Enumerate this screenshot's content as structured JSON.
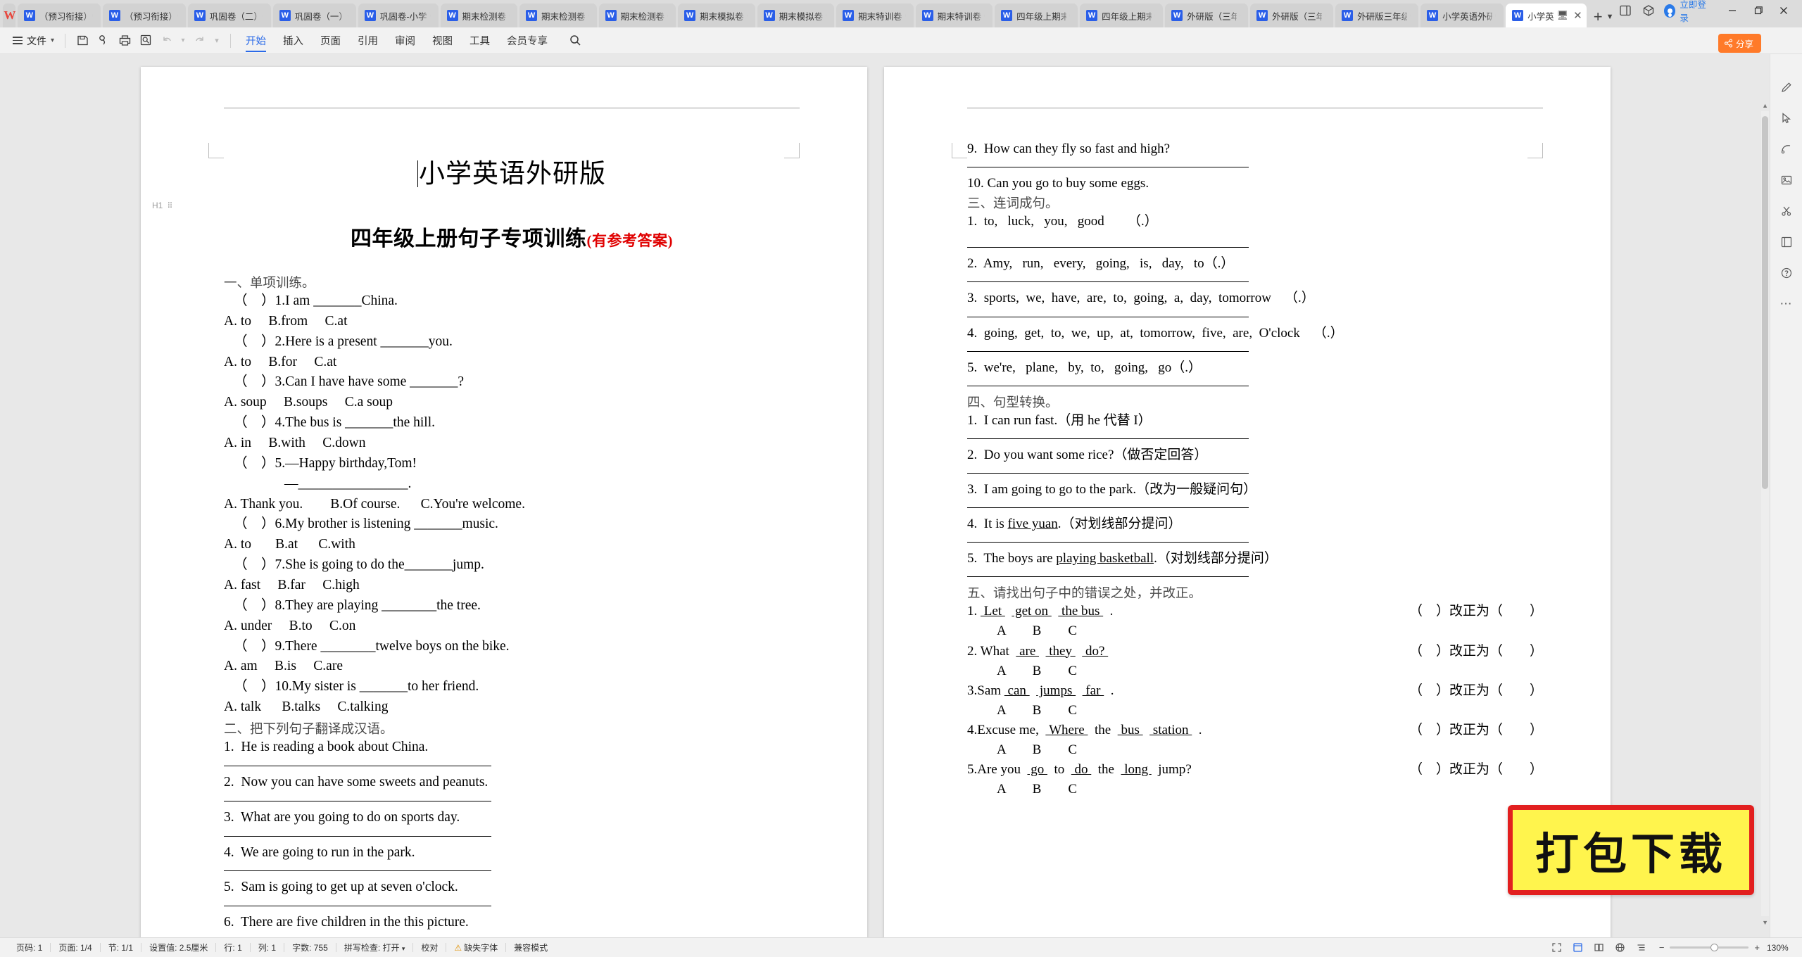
{
  "app": {
    "logo": "W",
    "login_label": "立即登录"
  },
  "tabs": [
    {
      "label": "（预习衔接）",
      "active": false,
      "dot": true
    },
    {
      "label": "（预习衔接）",
      "active": false,
      "dot": true
    },
    {
      "label": "巩固卷（二）",
      "active": false,
      "dot": true
    },
    {
      "label": "巩固卷（一）",
      "active": false,
      "dot": true
    },
    {
      "label": "巩固卷-小学",
      "active": false,
      "dot": true
    },
    {
      "label": "期末检测卷",
      "active": false,
      "dot": true
    },
    {
      "label": "期末检测卷",
      "active": false,
      "dot": true
    },
    {
      "label": "期末检测卷",
      "active": false,
      "dot": true
    },
    {
      "label": "期末模拟卷",
      "active": false,
      "dot": true
    },
    {
      "label": "期末模拟卷",
      "active": false,
      "dot": true
    },
    {
      "label": "期末特训卷",
      "active": false,
      "dot": true
    },
    {
      "label": "期末特训卷",
      "active": false,
      "dot": true
    },
    {
      "label": "四年级上期末",
      "active": false,
      "dot": true
    },
    {
      "label": "四年级上期末",
      "active": false,
      "dot": true
    },
    {
      "label": "外研版（三年",
      "active": false,
      "dot": true
    },
    {
      "label": "外研版（三年",
      "active": false,
      "dot": true
    },
    {
      "label": "外研版三年级",
      "active": false,
      "dot": true
    },
    {
      "label": "小学英语外研",
      "active": false,
      "dot": true
    },
    {
      "label": "小学英",
      "active": true,
      "dot": false
    }
  ],
  "menu": {
    "file_label": "文件",
    "tabs": [
      {
        "label": "开始",
        "active": true
      },
      {
        "label": "插入",
        "active": false
      },
      {
        "label": "页面",
        "active": false
      },
      {
        "label": "引用",
        "active": false
      },
      {
        "label": "审阅",
        "active": false
      },
      {
        "label": "视图",
        "active": false
      },
      {
        "label": "工具",
        "active": false
      },
      {
        "label": "会员专享",
        "active": false
      }
    ],
    "quick_icons": [
      "save-icon",
      "link-icon",
      "print-icon",
      "print-preview-icon",
      "undo-icon",
      "redo-icon",
      "more-chevron-icon"
    ]
  },
  "share_button": "分享",
  "document": {
    "title": "小学英语外研版",
    "subtitle": "四年级上册句子专项训练",
    "subtitle_note": "(有参考答案)",
    "paragraph_handle": "H1",
    "left_page": {
      "section1_head": "一、单项训练。",
      "questions": [
        {
          "stem": "（    ）1.I am _______China.",
          "options": "A. to     B.from     C.at"
        },
        {
          "stem": "（    ）2.Here is a present _______you.",
          "options": "A. to     B.for     C.at"
        },
        {
          "stem": "（    ）3.Can I have have some _______?",
          "options": "A. soup     B.soups     C.a soup"
        },
        {
          "stem": "（    ）4.The bus is _______the hill.",
          "options": "A. in     B.with     C.down"
        },
        {
          "stem": "（    ）5.—Happy birthday,Tom!",
          "sub": "—________________.",
          "options": "A. Thank you.        B.Of course.      C.You're welcome."
        },
        {
          "stem": "（    ）6.My brother is listening _______music.",
          "options": "A. to       B.at      C.with"
        },
        {
          "stem": "（    ）7.She is going to do the_______jump.",
          "options": "A. fast     B.far     C.high"
        },
        {
          "stem": "（    ）8.They are playing ________the tree.",
          "options": "A. under     B.to     C.on"
        },
        {
          "stem": "（    ）9.There ________twelve boys on the bike.",
          "options": "A. am     B.is     C.are"
        },
        {
          "stem": "（    ）10.My sister is _______to her friend.",
          "options": "A. talk      B.talks     C.talking"
        }
      ],
      "section2_head": "二、把下列句子翻译成汉语。",
      "translate": [
        "1.  He is reading a book about China.",
        "2.  Now you can have some sweets and peanuts.",
        "3.  What are you going to do on sports day.",
        "4.  We are going to run in the park.",
        "5.  Sam is going to get up at seven o'clock.",
        "6.  There are five children in the this picture."
      ]
    },
    "right_page": {
      "translate_cont": [
        "9.  How can they fly so fast and high?",
        "10. Can you go to buy some eggs."
      ],
      "section3_head": "三、连词成句。",
      "wordorder": [
        "1.  to,   luck,   you,   good       （.）",
        "2.  Amy,   run,   every,   going,   is,   day,   to（.）",
        "3.  sports,  we,  have,  are,  to,  going,  a,  day,  tomorrow    （.）",
        "4.  going,  get,  to,  we,  up,  at,  tomorrow,  five,  are,  O'clock    （.）",
        "5.  we're,   plane,   by,  to,   going,   go（.）"
      ],
      "section4_head": "四、句型转换。",
      "transform": [
        {
          "pre": "1.  I can run fast.（用 he 代替 I）"
        },
        {
          "pre": "2.  Do you want some rice?（做否定回答）"
        },
        {
          "pre": "3.  I am going to go to the park.（改为一般疑问句）"
        },
        {
          "pre": "4.  It is ",
          "ul": "five yuan",
          "post": ".（对划线部分提问）"
        },
        {
          "pre": "5.  The boys are ",
          "ul": "playing basketball",
          "post": ".（对划线部分提问）"
        }
      ],
      "section5_head": "五、请找出句子中的错误之处，并改正。",
      "correct_suffix": "）改正为（        ）",
      "correct_open": "（",
      "corrections": [
        {
          "num": "1.",
          "parts": [
            {
              "t": "Let",
              "ul": true
            },
            {
              "t": "get on",
              "ul": true
            },
            {
              "t": "the bus",
              "ul": true
            },
            {
              "t": ".",
              "ul": false
            }
          ],
          "marks": [
            "A",
            "B",
            "C"
          ]
        },
        {
          "num": "2.",
          "parts": [
            {
              "t": "What",
              "ul": false
            },
            {
              "t": "are",
              "ul": true
            },
            {
              "t": "they",
              "ul": true
            },
            {
              "t": "do?",
              "ul": true
            }
          ],
          "marks": [
            "A",
            "B",
            "C"
          ]
        },
        {
          "num": "3.Sam",
          "parts": [
            {
              "t": "can",
              "ul": true
            },
            {
              "t": "jumps",
              "ul": true
            },
            {
              "t": "far",
              "ul": true
            },
            {
              "t": ".",
              "ul": false
            }
          ],
          "marks": [
            "A",
            "B",
            "C"
          ]
        },
        {
          "num": "4.Excuse",
          "parts": [
            {
              "t": "me,",
              "ul": false
            },
            {
              "t": "Where",
              "ul": true
            },
            {
              "t": "the",
              "ul": false
            },
            {
              "t": "bus",
              "ul": true
            },
            {
              "t": "station",
              "ul": true
            },
            {
              "t": ".",
              "ul": false
            }
          ],
          "marks": [
            "A",
            "B",
            "C"
          ]
        },
        {
          "num": "5.Are",
          "parts": [
            {
              "t": "you",
              "ul": false
            },
            {
              "t": "go",
              "ul": true
            },
            {
              "t": "to",
              "ul": false
            },
            {
              "t": "do",
              "ul": true
            },
            {
              "t": "the",
              "ul": false
            },
            {
              "t": "long",
              "ul": true
            },
            {
              "t": "jump?",
              "ul": false
            }
          ],
          "marks": [
            "A",
            "B",
            "C"
          ]
        }
      ]
    }
  },
  "watermark": {
    "text": "打包下载",
    "bg_color": "#fff44d",
    "border_color": "#e21f1f"
  },
  "status_bar": {
    "items": [
      "页码: 1",
      "页面: 1/4",
      "节: 1/1",
      "设置值: 2.5厘米",
      "行: 1",
      "列: 1",
      "字数: 755",
      "拼写检查: 打开",
      "校对",
      "缺失字体",
      "兼容模式"
    ],
    "zoom": "130%",
    "zoom_minus": "−",
    "zoom_plus": "+"
  }
}
